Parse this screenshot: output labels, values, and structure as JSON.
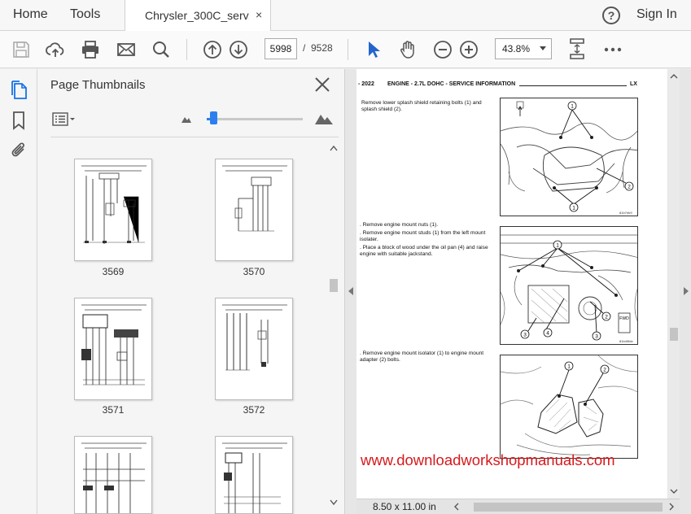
{
  "menubar": {
    "home": "Home",
    "tools": "Tools",
    "tab_title": "Chrysler_300C_serv...",
    "tab_close": "×",
    "help": "?",
    "sign_in": "Sign In"
  },
  "toolbar": {
    "current_page": "5998",
    "page_separator": "/",
    "total_pages": "9528",
    "zoom": "43.8%",
    "icons": [
      "save-icon",
      "upload-icon",
      "print-icon",
      "mail-icon",
      "search-icon",
      "prev-page-icon",
      "next-page-icon",
      "select-cursor-icon",
      "hand-icon",
      "zoom-out-icon",
      "zoom-in-icon",
      "fit-page-icon",
      "more-icon"
    ]
  },
  "rail": {
    "icons": [
      "page-thumbnails-icon",
      "bookmark-icon",
      "attachment-icon"
    ]
  },
  "thumbnails": {
    "title": "Page Thumbnails",
    "pages": [
      "3569",
      "3570",
      "3571",
      "3572"
    ]
  },
  "document": {
    "header_page": "- 2022",
    "header_title": "ENGINE - 2.7L DOHC - SERVICE INFORMATION",
    "header_code": "LX",
    "step1": "Remove lower splash shield retaining bolts (1) and splash shield (2).",
    "step2a": ". Remove engine mount nuts (1).",
    "step2b": ". Remove engine mount studs (1) from the left mount isolater.",
    "step2c": ". Place a block of wood under the oil pan (4) and raise engine with suitable jackstand.",
    "step3": ". Remove engine mount isolator (1) to engine mount adapter (2) bolts.",
    "fig1_code": "81b7eb9",
    "fig2_code": "81b49fde",
    "fig3_code": "81102f4a",
    "watermark": "www.downloadworkshopmanuals.com",
    "page_size": "8.50 x 11.00 in",
    "callouts": {
      "fig1": [
        "1",
        "1",
        "2"
      ],
      "fig2": [
        "1",
        "2",
        "3",
        "4",
        "3"
      ],
      "fig3": [
        "1",
        "2"
      ],
      "fwd": "FWD"
    }
  },
  "colors": {
    "accent": "#2d7ff0",
    "watermark": "#d6191b",
    "cursor": "#2266cc"
  }
}
